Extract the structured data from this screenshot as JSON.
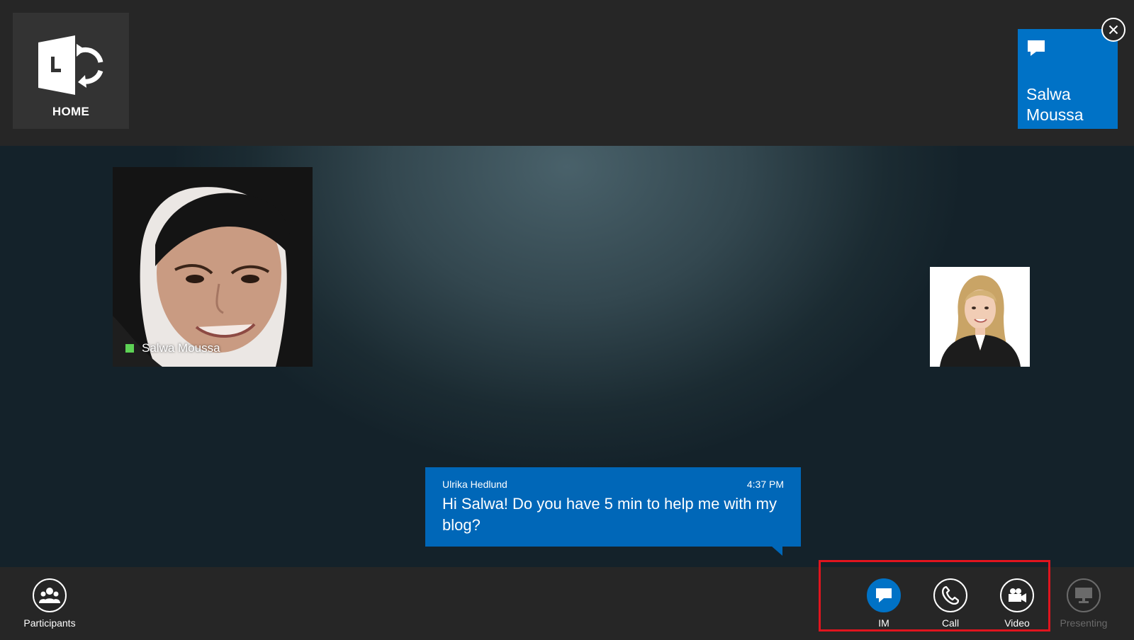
{
  "topbar": {
    "home": {
      "label": "HOME",
      "logo_icon": "lync-logo-icon"
    },
    "conversation_tile": {
      "name": "Salwa Moussa",
      "icon": "chat-bubble-icon",
      "color": "#0072c6"
    },
    "close_icon": "close-icon"
  },
  "stage": {
    "main_participant": {
      "name": "Salwa Moussa",
      "presence": "available",
      "presence_color": "#5dd255"
    },
    "self_participant": {
      "icon": "avatar"
    },
    "message": {
      "sender": "Ulrika Hedlund",
      "time": "4:37 PM",
      "text": "Hi Salwa! Do you have 5 min to help me with my blog?",
      "color": "#0067b8"
    }
  },
  "bottombar": {
    "participants": {
      "label": "Participants",
      "icon": "participants-icon"
    },
    "im": {
      "label": "IM",
      "icon": "chat-bubble-icon",
      "active": true
    },
    "call": {
      "label": "Call",
      "icon": "phone-icon"
    },
    "video": {
      "label": "Video",
      "icon": "video-camera-icon"
    },
    "presenting": {
      "label": "Presenting",
      "icon": "monitor-icon",
      "disabled": true
    },
    "highlight_color": "#e0141e"
  }
}
